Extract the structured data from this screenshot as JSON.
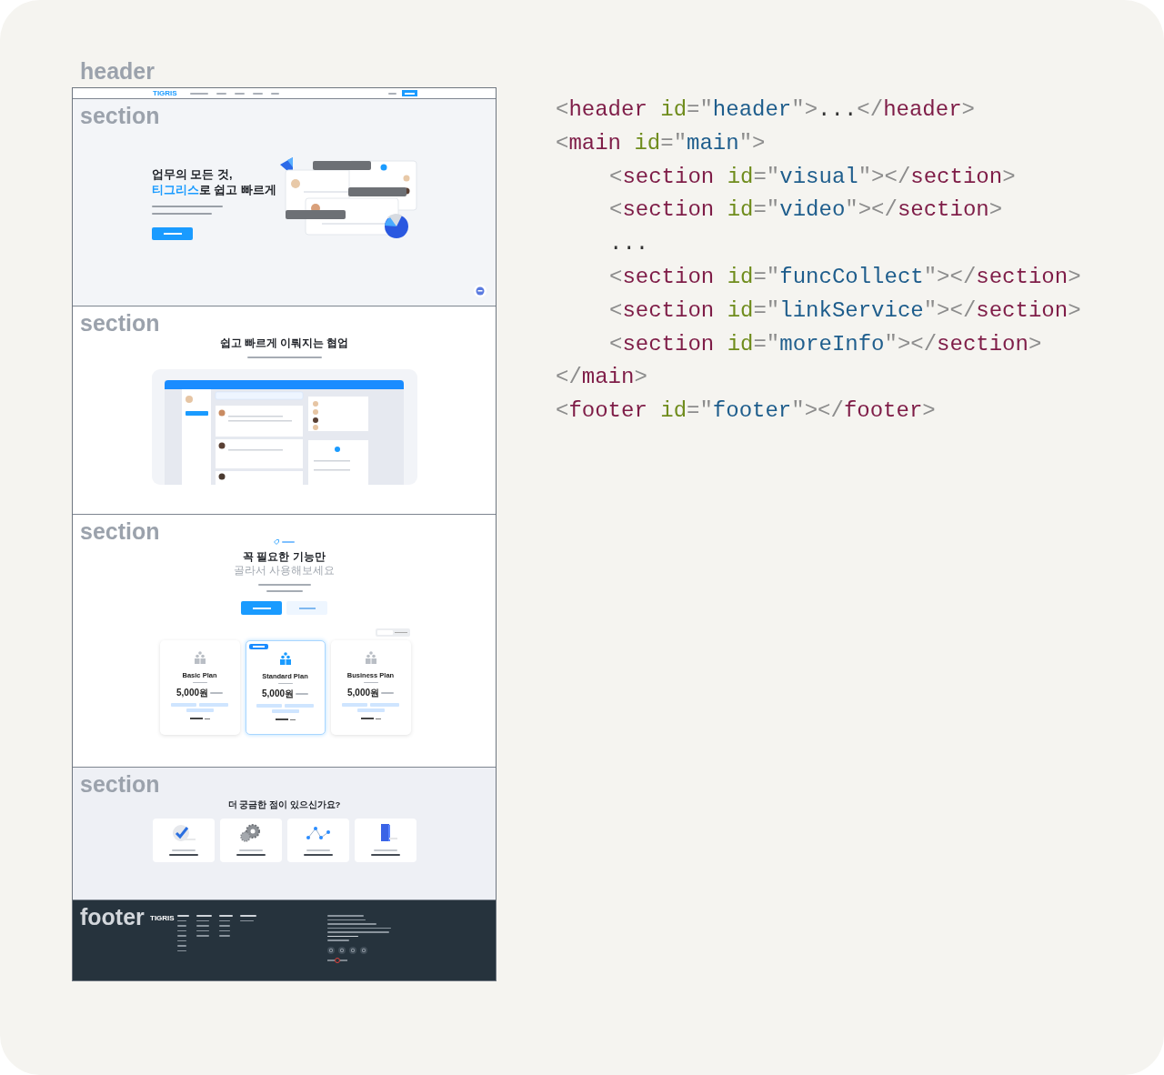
{
  "header": {
    "label": "header",
    "logo": "TIGRIS"
  },
  "hero": {
    "label": "section",
    "title_line_1": "업무의 모든 것,",
    "title_line_2": {
      "highlight": "티그리스",
      "rest": "로 쉽고 빠르게"
    }
  },
  "collaboration": {
    "label": "section",
    "title": "쉽고 빠르게 이뤄지는 협업"
  },
  "pricing": {
    "label": "section",
    "title": "꼭 필요한 기능만",
    "subtitle": "골라서 사용해보세요",
    "plans": [
      {
        "name": "Basic Plan",
        "price": "5,000원",
        "featured": false
      },
      {
        "name": "Standard Plan",
        "price": "5,000원",
        "featured": true
      },
      {
        "name": "Business Plan",
        "price": "5,000원",
        "featured": false
      }
    ]
  },
  "faq": {
    "label": "section",
    "title": "더 궁금한 점이 있으신가요?"
  },
  "footer": {
    "label": "footer",
    "logo": "TIGRIS"
  },
  "code": {
    "lines": [
      {
        "tokens": [
          {
            "kind": "punct",
            "text": "<"
          },
          {
            "kind": "tag",
            "text": "header"
          },
          {
            "kind": "attr",
            "text": " id"
          },
          {
            "kind": "punct",
            "text": "=\""
          },
          {
            "kind": "value",
            "text": "header"
          },
          {
            "kind": "punct",
            "text": "\">"
          },
          {
            "kind": "text",
            "text": "..."
          },
          {
            "kind": "punct",
            "text": "</"
          },
          {
            "kind": "tag",
            "text": "header"
          },
          {
            "kind": "punct",
            "text": ">"
          }
        ]
      },
      {
        "tokens": [
          {
            "kind": "punct",
            "text": "<"
          },
          {
            "kind": "tag",
            "text": "main"
          },
          {
            "kind": "attr",
            "text": " id"
          },
          {
            "kind": "punct",
            "text": "=\""
          },
          {
            "kind": "value",
            "text": "main"
          },
          {
            "kind": "punct",
            "text": "\">"
          }
        ],
        "children": [
          {
            "tokens": [
              {
                "kind": "punct",
                "text": "<"
              },
              {
                "kind": "tag",
                "text": "section"
              },
              {
                "kind": "attr",
                "text": " id"
              },
              {
                "kind": "punct",
                "text": "=\""
              },
              {
                "kind": "value",
                "text": "visual"
              },
              {
                "kind": "punct",
                "text": "\"></"
              },
              {
                "kind": "tag",
                "text": "section"
              },
              {
                "kind": "punct",
                "text": ">"
              }
            ]
          },
          {
            "tokens": [
              {
                "kind": "punct",
                "text": "<"
              },
              {
                "kind": "tag",
                "text": "section"
              },
              {
                "kind": "attr",
                "text": " id"
              },
              {
                "kind": "punct",
                "text": "=\""
              },
              {
                "kind": "value",
                "text": "video"
              },
              {
                "kind": "punct",
                "text": "\"></"
              },
              {
                "kind": "tag",
                "text": "section"
              },
              {
                "kind": "punct",
                "text": ">"
              }
            ]
          },
          {
            "tokens": [
              {
                "kind": "text",
                "text": "..."
              }
            ]
          },
          {
            "tokens": [
              {
                "kind": "punct",
                "text": "<"
              },
              {
                "kind": "tag",
                "text": "section"
              },
              {
                "kind": "attr",
                "text": " id"
              },
              {
                "kind": "punct",
                "text": "=\""
              },
              {
                "kind": "value",
                "text": "funcCollect"
              },
              {
                "kind": "punct",
                "text": "\"></"
              },
              {
                "kind": "tag",
                "text": "section"
              },
              {
                "kind": "punct",
                "text": ">"
              }
            ]
          },
          {
            "tokens": [
              {
                "kind": "punct",
                "text": "<"
              },
              {
                "kind": "tag",
                "text": "section"
              },
              {
                "kind": "attr",
                "text": " id"
              },
              {
                "kind": "punct",
                "text": "=\""
              },
              {
                "kind": "value",
                "text": "linkService"
              },
              {
                "kind": "punct",
                "text": "\"></"
              },
              {
                "kind": "tag",
                "text": "section"
              },
              {
                "kind": "punct",
                "text": ">"
              }
            ]
          },
          {
            "tokens": [
              {
                "kind": "punct",
                "text": "<"
              },
              {
                "kind": "tag",
                "text": "section"
              },
              {
                "kind": "attr",
                "text": " id"
              },
              {
                "kind": "punct",
                "text": "=\""
              },
              {
                "kind": "value",
                "text": "moreInfo"
              },
              {
                "kind": "punct",
                "text": "\"></"
              },
              {
                "kind": "tag",
                "text": "section"
              },
              {
                "kind": "punct",
                "text": ">"
              }
            ]
          }
        ]
      },
      {
        "tokens": [
          {
            "kind": "punct",
            "text": "</"
          },
          {
            "kind": "tag",
            "text": "main"
          },
          {
            "kind": "punct",
            "text": ">"
          }
        ]
      },
      {
        "tokens": [
          {
            "kind": "punct",
            "text": "<"
          },
          {
            "kind": "tag",
            "text": "footer"
          },
          {
            "kind": "attr",
            "text": " id"
          },
          {
            "kind": "punct",
            "text": "=\""
          },
          {
            "kind": "value",
            "text": "footer"
          },
          {
            "kind": "punct",
            "text": "\"></"
          },
          {
            "kind": "tag",
            "text": "footer"
          },
          {
            "kind": "punct",
            "text": ">"
          }
        ]
      }
    ]
  }
}
